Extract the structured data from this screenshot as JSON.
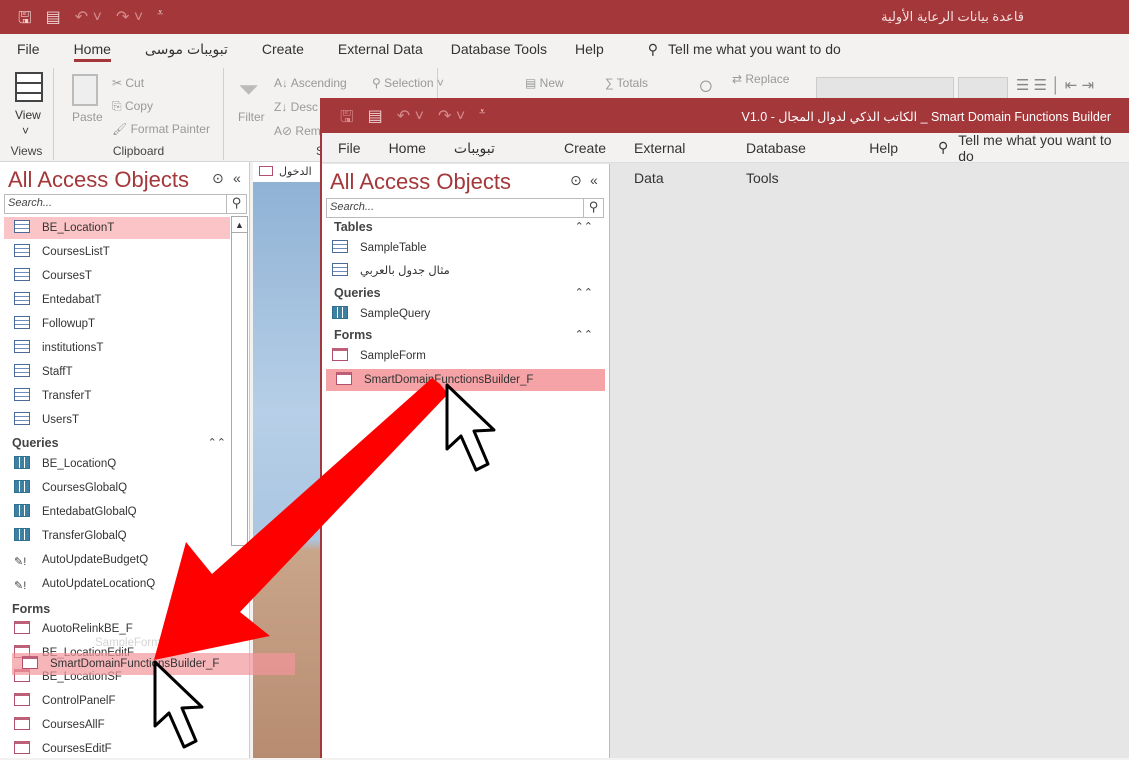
{
  "outer": {
    "title": "قاعدة بيانات الرعاية الأولية",
    "qat": [
      "save-icon",
      "object-icon",
      "undo-icon",
      "redo-icon",
      "customize-icon"
    ],
    "tabs": [
      "File",
      "Home",
      "تبويبات موسى",
      "Create",
      "External Data",
      "Database Tools",
      "Help"
    ],
    "active_tab": "Home",
    "tell_me": "Tell me what you want to do",
    "ribbon": {
      "views": {
        "label": "Views",
        "view": "View"
      },
      "clipboard": {
        "label": "Clipboard",
        "paste": "Paste",
        "cut": "Cut",
        "copy": "Copy",
        "format_painter": "Format Painter"
      },
      "sort": {
        "filter": "Filter",
        "ascending": "Ascending",
        "descending": "Desc",
        "remove": "Rem",
        "selection": "Selection",
        "label": "S"
      },
      "records": {
        "new": "New",
        "totals": "Totals"
      },
      "find": {
        "replace": "Replace"
      }
    },
    "nav": {
      "title": "All Access Objects",
      "search_placeholder": "Search...",
      "tables": [
        "BE_LocationT",
        "CoursesListT",
        "CoursesT",
        "EntedabatT",
        "FollowupT",
        "institutionsT",
        "StaffT",
        "TransferT",
        "UsersT"
      ],
      "queries_label": "Queries",
      "queries": [
        {
          "name": "BE_LocationQ",
          "type": "select"
        },
        {
          "name": "CoursesGlobalQ",
          "type": "select"
        },
        {
          "name": "EntedabatGlobalQ",
          "type": "select"
        },
        {
          "name": "TransferGlobalQ",
          "type": "select"
        },
        {
          "name": "AutoUpdateBudgetQ",
          "type": "action"
        },
        {
          "name": "AutoUpdateLocationQ",
          "type": "action"
        }
      ],
      "forms_label": "Forms",
      "forms": [
        "AuotoRelinkBE_F",
        "BE_LocationEditF",
        "BE_LocationSF",
        "ControlPanelF",
        "CoursesAllF",
        "CoursesEditF"
      ]
    },
    "doc_tab": "الدخول",
    "drag_ghost": "SmartDomainFunctionsBuilder_F",
    "drag_ghost_faint": "SampleForm"
  },
  "inner": {
    "title": "V1.0  -  الكاتب الذكي لدوال المجال _ Smart Domain Functions Builder",
    "tabs": [
      "File",
      "Home",
      "تبويبات موسى",
      "Create",
      "External Data",
      "Database Tools",
      "Help"
    ],
    "tell_me": "Tell me what you want to do",
    "nav": {
      "title": "All Access Objects",
      "search_placeholder": "Search...",
      "tables_label": "Tables",
      "tables": [
        "SampleTable",
        "مثال جدول بالعربي"
      ],
      "queries_label": "Queries",
      "queries": [
        "SampleQuery"
      ],
      "forms_label": "Forms",
      "forms": [
        "SampleForm",
        "SmartDomainFunctionsBuilder_F"
      ]
    }
  },
  "colors": {
    "accent": "#a4373a",
    "selection": "#fbc4c6",
    "arrow": "#ff0000"
  }
}
